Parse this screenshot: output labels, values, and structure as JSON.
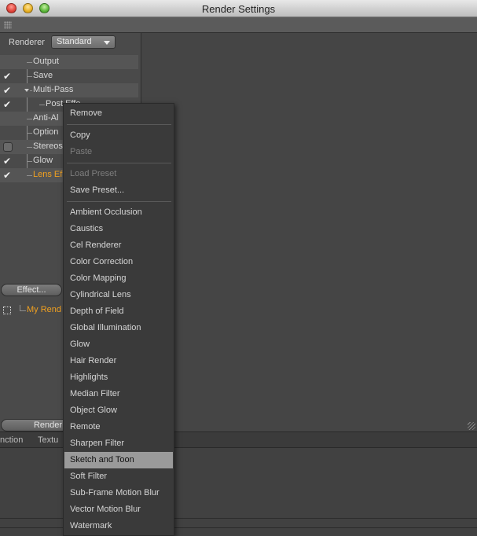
{
  "window": {
    "title": "Render Settings"
  },
  "renderer": {
    "label": "Renderer",
    "value": "Standard"
  },
  "tree": [
    {
      "label": "Output",
      "checked": null
    },
    {
      "label": "Save",
      "checked": true
    },
    {
      "label": "Multi-Pass",
      "checked": true
    },
    {
      "label": "Post Effects",
      "checked": true
    },
    {
      "label": "Anti-Aliasing",
      "checked": null
    },
    {
      "label": "Options",
      "checked": null
    },
    {
      "label": "Stereoscopic",
      "checked": false
    },
    {
      "label": "Glow",
      "checked": true
    },
    {
      "label": "Lens Effects",
      "checked": true
    }
  ],
  "tree_visible": [
    "Output",
    "Save",
    "Multi-Pass",
    "Post Effe",
    "Anti-Al",
    "Option",
    "Stereos",
    "Glow",
    "Lens Ef"
  ],
  "effect_button": "Effect...",
  "render_item": "My Rend",
  "render_button": "Render",
  "lower_tabs": [
    "nction",
    "Textu"
  ],
  "menu": {
    "group1": [
      "Remove"
    ],
    "group2": [
      {
        "label": "Copy",
        "enabled": true
      },
      {
        "label": "Paste",
        "enabled": false
      }
    ],
    "group3": [
      {
        "label": "Load Preset",
        "enabled": false
      },
      {
        "label": "Save Preset...",
        "enabled": true
      }
    ],
    "effects": [
      "Ambient Occlusion",
      "Caustics",
      "Cel Renderer",
      "Color Correction",
      "Color Mapping",
      "Cylindrical Lens",
      "Depth of Field",
      "Global Illumination",
      "Glow",
      "Hair Render",
      "Highlights",
      "Median Filter",
      "Object Glow",
      "Remote",
      "Sharpen Filter",
      "Sketch and Toon",
      "Soft Filter",
      "Sub-Frame Motion Blur",
      "Vector Motion Blur",
      "Watermark"
    ],
    "highlighted": "Sketch and Toon"
  },
  "colors": {
    "accent_orange": "#f0a020",
    "menu_highlight": "#9a9a9a"
  }
}
